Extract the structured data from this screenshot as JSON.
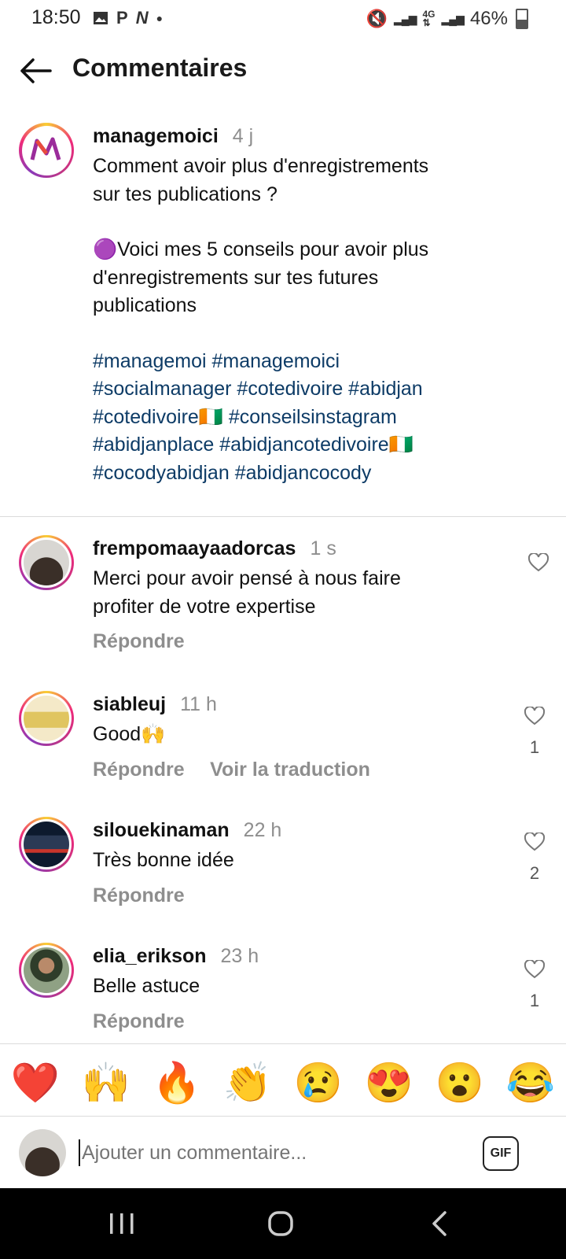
{
  "status_bar": {
    "time": "18:50",
    "left_icons": [
      "image-icon",
      "p-icon",
      "n-icon",
      "dot-icon"
    ],
    "battery": "46%"
  },
  "header": {
    "title": "Commentaires"
  },
  "caption": {
    "username": "managemoici",
    "time": "4 j",
    "line1": "Comment avoir plus d'enregistrements",
    "line2": "sur tes publications ?",
    "line3": "🟣Voici mes 5 conseils pour avoir plus",
    "line4": "d'enregistrements sur tes futures",
    "line5": "publications",
    "tags": [
      "#managemoi #managemoici",
      "#socialmanager #cotedivoire #abidjan",
      "#cotedivoire🇨🇮 #conseilsinstagram",
      "#abidjanplace #abidjancotedivoire🇨🇮",
      "#cocodyabidjan #abidjancocody"
    ]
  },
  "comments": [
    {
      "username": "frempomaayaadorcas",
      "time": "1 s",
      "text1": "Merci pour avoir pensé à nous faire",
      "text2": "profiter de votre expertise",
      "reply": "Répondre",
      "likes": ""
    },
    {
      "username": "siableuj",
      "time": "11 h",
      "text1": "Good🙌",
      "reply": "Répondre",
      "translate": "Voir la traduction",
      "likes": "1"
    },
    {
      "username": "silouekinaman",
      "time": "22 h",
      "text1": "Très bonne idée",
      "reply": "Répondre",
      "likes": "2"
    },
    {
      "username": "elia_erikson",
      "time": "23 h",
      "text1": "Belle astuce",
      "reply": "Répondre",
      "likes": "1"
    }
  ],
  "emoji_bar": [
    "❤️",
    "🙌",
    "🔥",
    "👏",
    "😢",
    "😍",
    "😮",
    "😂"
  ],
  "composer": {
    "placeholder": "Ajouter un commentaire...",
    "gif_label": "GIF"
  },
  "colors": {
    "hashtag": "#0d3b66",
    "secondary_text": "#8e8e8e",
    "nav_bar": "#000000"
  }
}
